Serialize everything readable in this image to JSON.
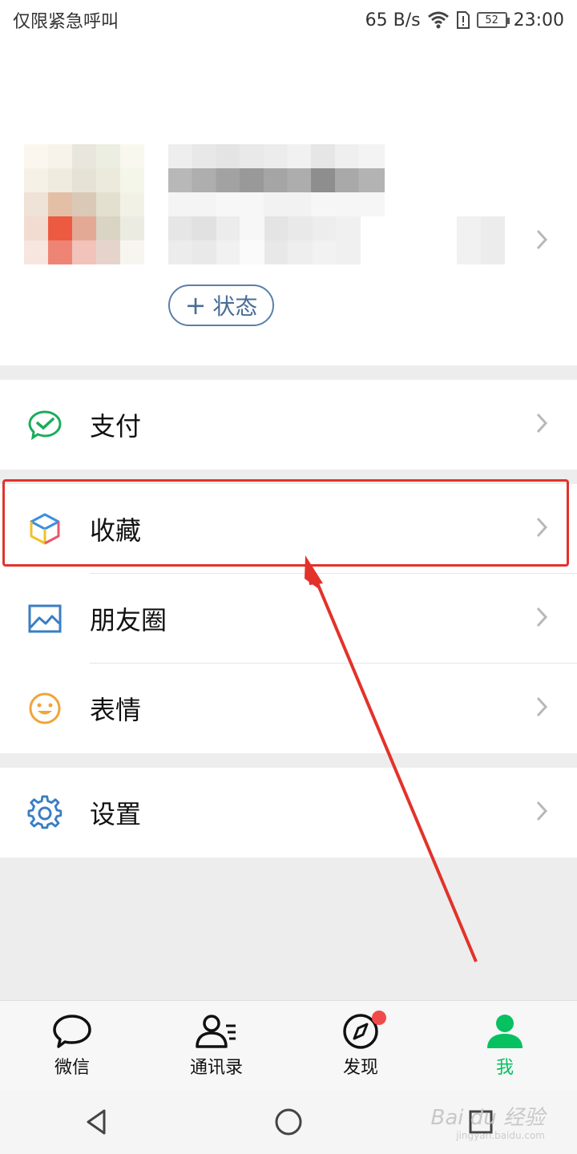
{
  "status_bar": {
    "carrier": "仅限紧急呼叫",
    "speed": "65 B/s",
    "battery": "52",
    "time": "23:00"
  },
  "profile": {
    "status_button": "状态",
    "status_plus": "+"
  },
  "menu": {
    "pay": "支付",
    "favorites": "收藏",
    "moments": "朋友圈",
    "stickers": "表情",
    "settings": "设置"
  },
  "tabs": [
    {
      "label": "微信",
      "icon": "chat-bubble-icon"
    },
    {
      "label": "通讯录",
      "icon": "contacts-icon"
    },
    {
      "label": "发现",
      "icon": "compass-icon"
    },
    {
      "label": "我",
      "icon": "person-icon"
    }
  ],
  "watermark": {
    "brand": "Bai du 经验",
    "url": "jingyan.baidu.com"
  },
  "colors": {
    "accent": "#07c160",
    "highlight": "#e3322b",
    "link": "#4a6d96"
  }
}
